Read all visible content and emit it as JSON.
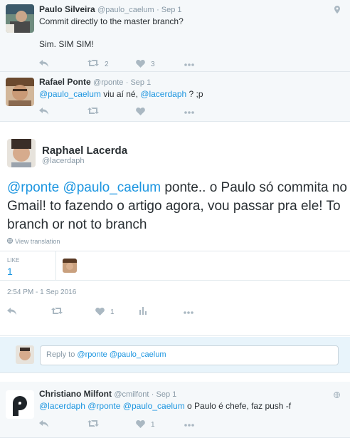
{
  "tweets": [
    {
      "fullname": "Paulo Silveira",
      "handle": "@paulo_caelum",
      "date": "· Sep 1",
      "lines": [
        "Commit directly to the master branch?",
        "",
        "Sim. SIM SIM!"
      ],
      "retweets": "2",
      "likes": "3"
    },
    {
      "fullname": "Rafael Ponte",
      "handle": "@rponte",
      "date": "· Sep 1",
      "mention1": "@paulo_caelum",
      "text_mid": " viu aí né, ",
      "mention2": "@lacerdaph",
      "text_end": " ? ;p"
    }
  ],
  "main": {
    "fullname": "Raphael Lacerda",
    "handle": "@lacerdaph",
    "mention1": "@rponte",
    "mention2": "@paulo_caelum",
    "text": " ponte.. o Paulo só commita no Gmail! to fazendo o artigo agora, vou passar pra ele! To branch or not to branch",
    "translate": "View translation",
    "likes_label": "LIKE",
    "likes_count": "1",
    "timestamp": "2:54 PM - 1 Sep 2016",
    "like_action_count": "1"
  },
  "reply": {
    "prefix": "Reply to ",
    "mentions": "@rponte @paulo_caelum"
  },
  "last": {
    "fullname": "Christiano Milfont",
    "handle": "@cmilfont",
    "date": "· Sep 1",
    "m1": "@lacerdaph",
    "m2": "@rponte",
    "m3": "@paulo_caelum",
    "text": " o Paulo é chefe, faz push -f",
    "likes": "1"
  },
  "colors": {
    "link": "#1b95e0",
    "meta": "#8899a6",
    "icon": "#aab8c2",
    "bg_ancestor": "#f5f8fa",
    "bg_reply": "#e8f4fb"
  },
  "icons": [
    "reply-icon",
    "retweet-icon",
    "heart-icon",
    "more-icon",
    "analytics-icon",
    "globe-icon",
    "location-icon"
  ]
}
